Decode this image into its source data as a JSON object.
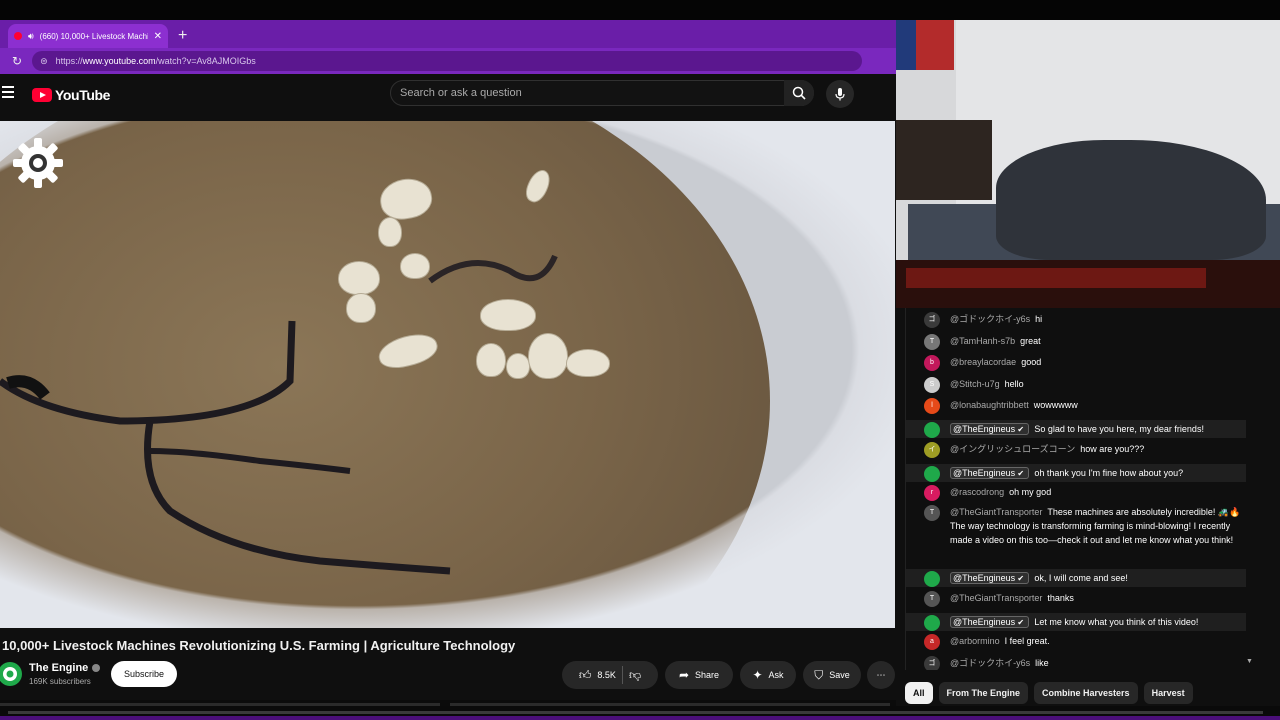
{
  "browser": {
    "tab_title": "(660) 10,000+ Livestock Machi",
    "new_tab": "+",
    "url_prefix": "https://",
    "url_host": "www.youtube.com",
    "url_path": "/watch?v=Av8AJMOIGbs"
  },
  "youtube": {
    "logo_text": "YouTube",
    "search_placeholder": "Search or ask a question"
  },
  "video": {
    "title": "10,000+ Livestock Machines Revolutionizing U.S. Farming | Agriculture Technology",
    "channel_name": "The Engine",
    "subscribers": "169K subscribers",
    "subscribe_label": "Subscribe",
    "like_count": "8.5K",
    "share_label": "Share",
    "ask_label": "Ask",
    "save_label": "Save",
    "more_label": "⋯"
  },
  "chat": {
    "messages": [
      {
        "author": "@ゴドックホイ-y6s",
        "text": "hi",
        "avatar_color": "#3a3a3a",
        "avatar_letter": "ゴ",
        "owner": false
      },
      {
        "author": "@TamHanh-s7b",
        "text": "great",
        "avatar_color": "#777777",
        "avatar_letter": "T",
        "owner": false
      },
      {
        "author": "@breaylacordae",
        "text": "good",
        "avatar_color": "#c2185b",
        "avatar_letter": "b",
        "owner": false
      },
      {
        "author": "@Stitch-u7g",
        "text": "hello",
        "avatar_color": "#cccccc",
        "avatar_letter": "S",
        "owner": false
      },
      {
        "author": "@lonabaughtribbett",
        "text": "wowwwww",
        "avatar_color": "#e64a19",
        "avatar_letter": "l",
        "owner": false
      },
      {
        "author": "@TheEngineus",
        "text": "So glad to have you here, my dear friends!",
        "avatar_color": "#1fa94a",
        "avatar_letter": "",
        "owner": true
      },
      {
        "author": "@イングリッシュローズコーン",
        "text": "how are you???",
        "avatar_color": "#9e9d24",
        "avatar_letter": "イ",
        "owner": false
      },
      {
        "author": "@TheEngineus",
        "text": "oh thank you I'm fine how about you?",
        "avatar_color": "#1fa94a",
        "avatar_letter": "",
        "owner": true
      },
      {
        "author": "@rascodrong",
        "text": "oh my god",
        "avatar_color": "#d81b60",
        "avatar_letter": "r",
        "owner": false
      },
      {
        "author": "@TheGiantTransporter",
        "text": "These machines are absolutely incredible! 🚜🔥 The way technology is transforming farming is mind-blowing! I recently made a video on this too—check it out and let me know what you think!",
        "avatar_color": "#555555",
        "avatar_letter": "T",
        "owner": false
      },
      {
        "author": "@TheEngineus",
        "text": "ok, I will come and see!",
        "avatar_color": "#1fa94a",
        "avatar_letter": "",
        "owner": true
      },
      {
        "author": "@TheGiantTransporter",
        "text": "thanks",
        "avatar_color": "#555555",
        "avatar_letter": "T",
        "owner": false
      },
      {
        "author": "@TheEngineus",
        "text": "Let me know what you think of this video!",
        "avatar_color": "#1fa94a",
        "avatar_letter": "",
        "owner": true
      },
      {
        "author": "@arbormino",
        "text": "I feel great.",
        "avatar_color": "#c62828",
        "avatar_letter": "a",
        "owner": false
      },
      {
        "author": "@ゴドックホイ-y6s",
        "text": "like",
        "avatar_color": "#3a3a3a",
        "avatar_letter": "ゴ",
        "owner": false
      }
    ]
  },
  "chips": [
    {
      "label": "All",
      "active": true
    },
    {
      "label": "From The Engine",
      "active": false
    },
    {
      "label": "Combine Harvesters",
      "active": false
    },
    {
      "label": "Harvest",
      "active": false
    }
  ],
  "colors": {
    "browser_accent": "#6a1ea8",
    "youtube_red": "#ff0033",
    "channel_green": "#1fa94a"
  }
}
